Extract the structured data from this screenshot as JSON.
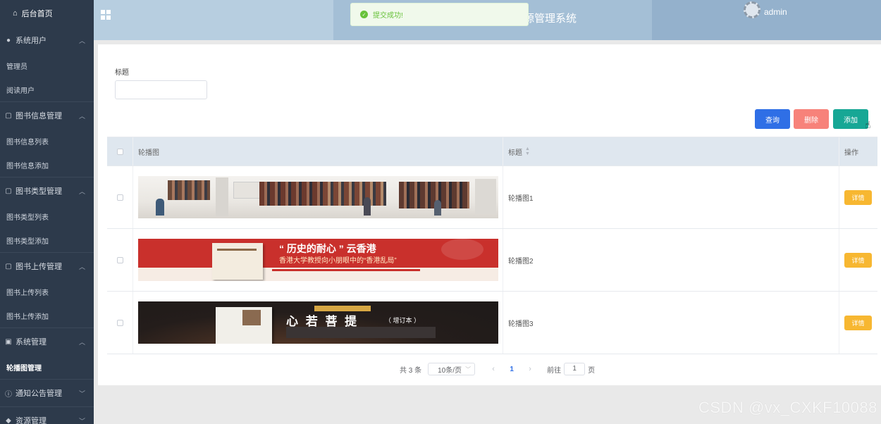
{
  "sidebar": {
    "home": "后台首页",
    "groups": [
      {
        "title": "系统用户",
        "items": [
          "管理员",
          "阅读用户"
        ]
      },
      {
        "title": "图书信息管理",
        "items": [
          "图书信息列表",
          "图书信息添加"
        ]
      },
      {
        "title": "图书类型管理",
        "items": [
          "图书类型列表",
          "图书类型添加"
        ]
      },
      {
        "title": "图书上传管理",
        "items": [
          "图书上传列表",
          "图书上传添加"
        ]
      },
      {
        "title": "系统管理",
        "items": [
          "轮播图管理"
        ]
      },
      {
        "title": "通知公告管理",
        "items": []
      },
      {
        "title": "资源管理",
        "items": []
      }
    ]
  },
  "header": {
    "system_title": "源管理系统",
    "user": "admin",
    "toast": "提交成功!"
  },
  "filter": {
    "label": "标题",
    "value": ""
  },
  "buttons": {
    "query": "查询",
    "delete": "删除",
    "add": "添加"
  },
  "table": {
    "columns": {
      "image": "轮播图",
      "title": "标题",
      "ops": "操作"
    },
    "rows": [
      {
        "title": "轮播图1",
        "action": "详情"
      },
      {
        "title": "轮播图2",
        "action": "详情",
        "banner_line1": "“ 历史的耐心 ” 云香港",
        "banner_line2": "香港大学教授向小朋眼中的“香港乱局”"
      },
      {
        "title": "轮播图3",
        "action": "详情",
        "banner_line1": "心 若 菩 提",
        "banner_tag": "（ 增订本 ）"
      }
    ]
  },
  "pagination": {
    "total": "共 3 条",
    "page_size": "10条/页",
    "current": "1",
    "goto_label": "前往",
    "goto_value": "1",
    "page_suffix": "页"
  },
  "watermark": "CSDN @vx_CXKF10088",
  "colors": {
    "sidebar": "#2d3a4b",
    "query": "#2f6fe6",
    "delete": "#f7827a",
    "add": "#17a795",
    "detail": "#f7b731"
  }
}
